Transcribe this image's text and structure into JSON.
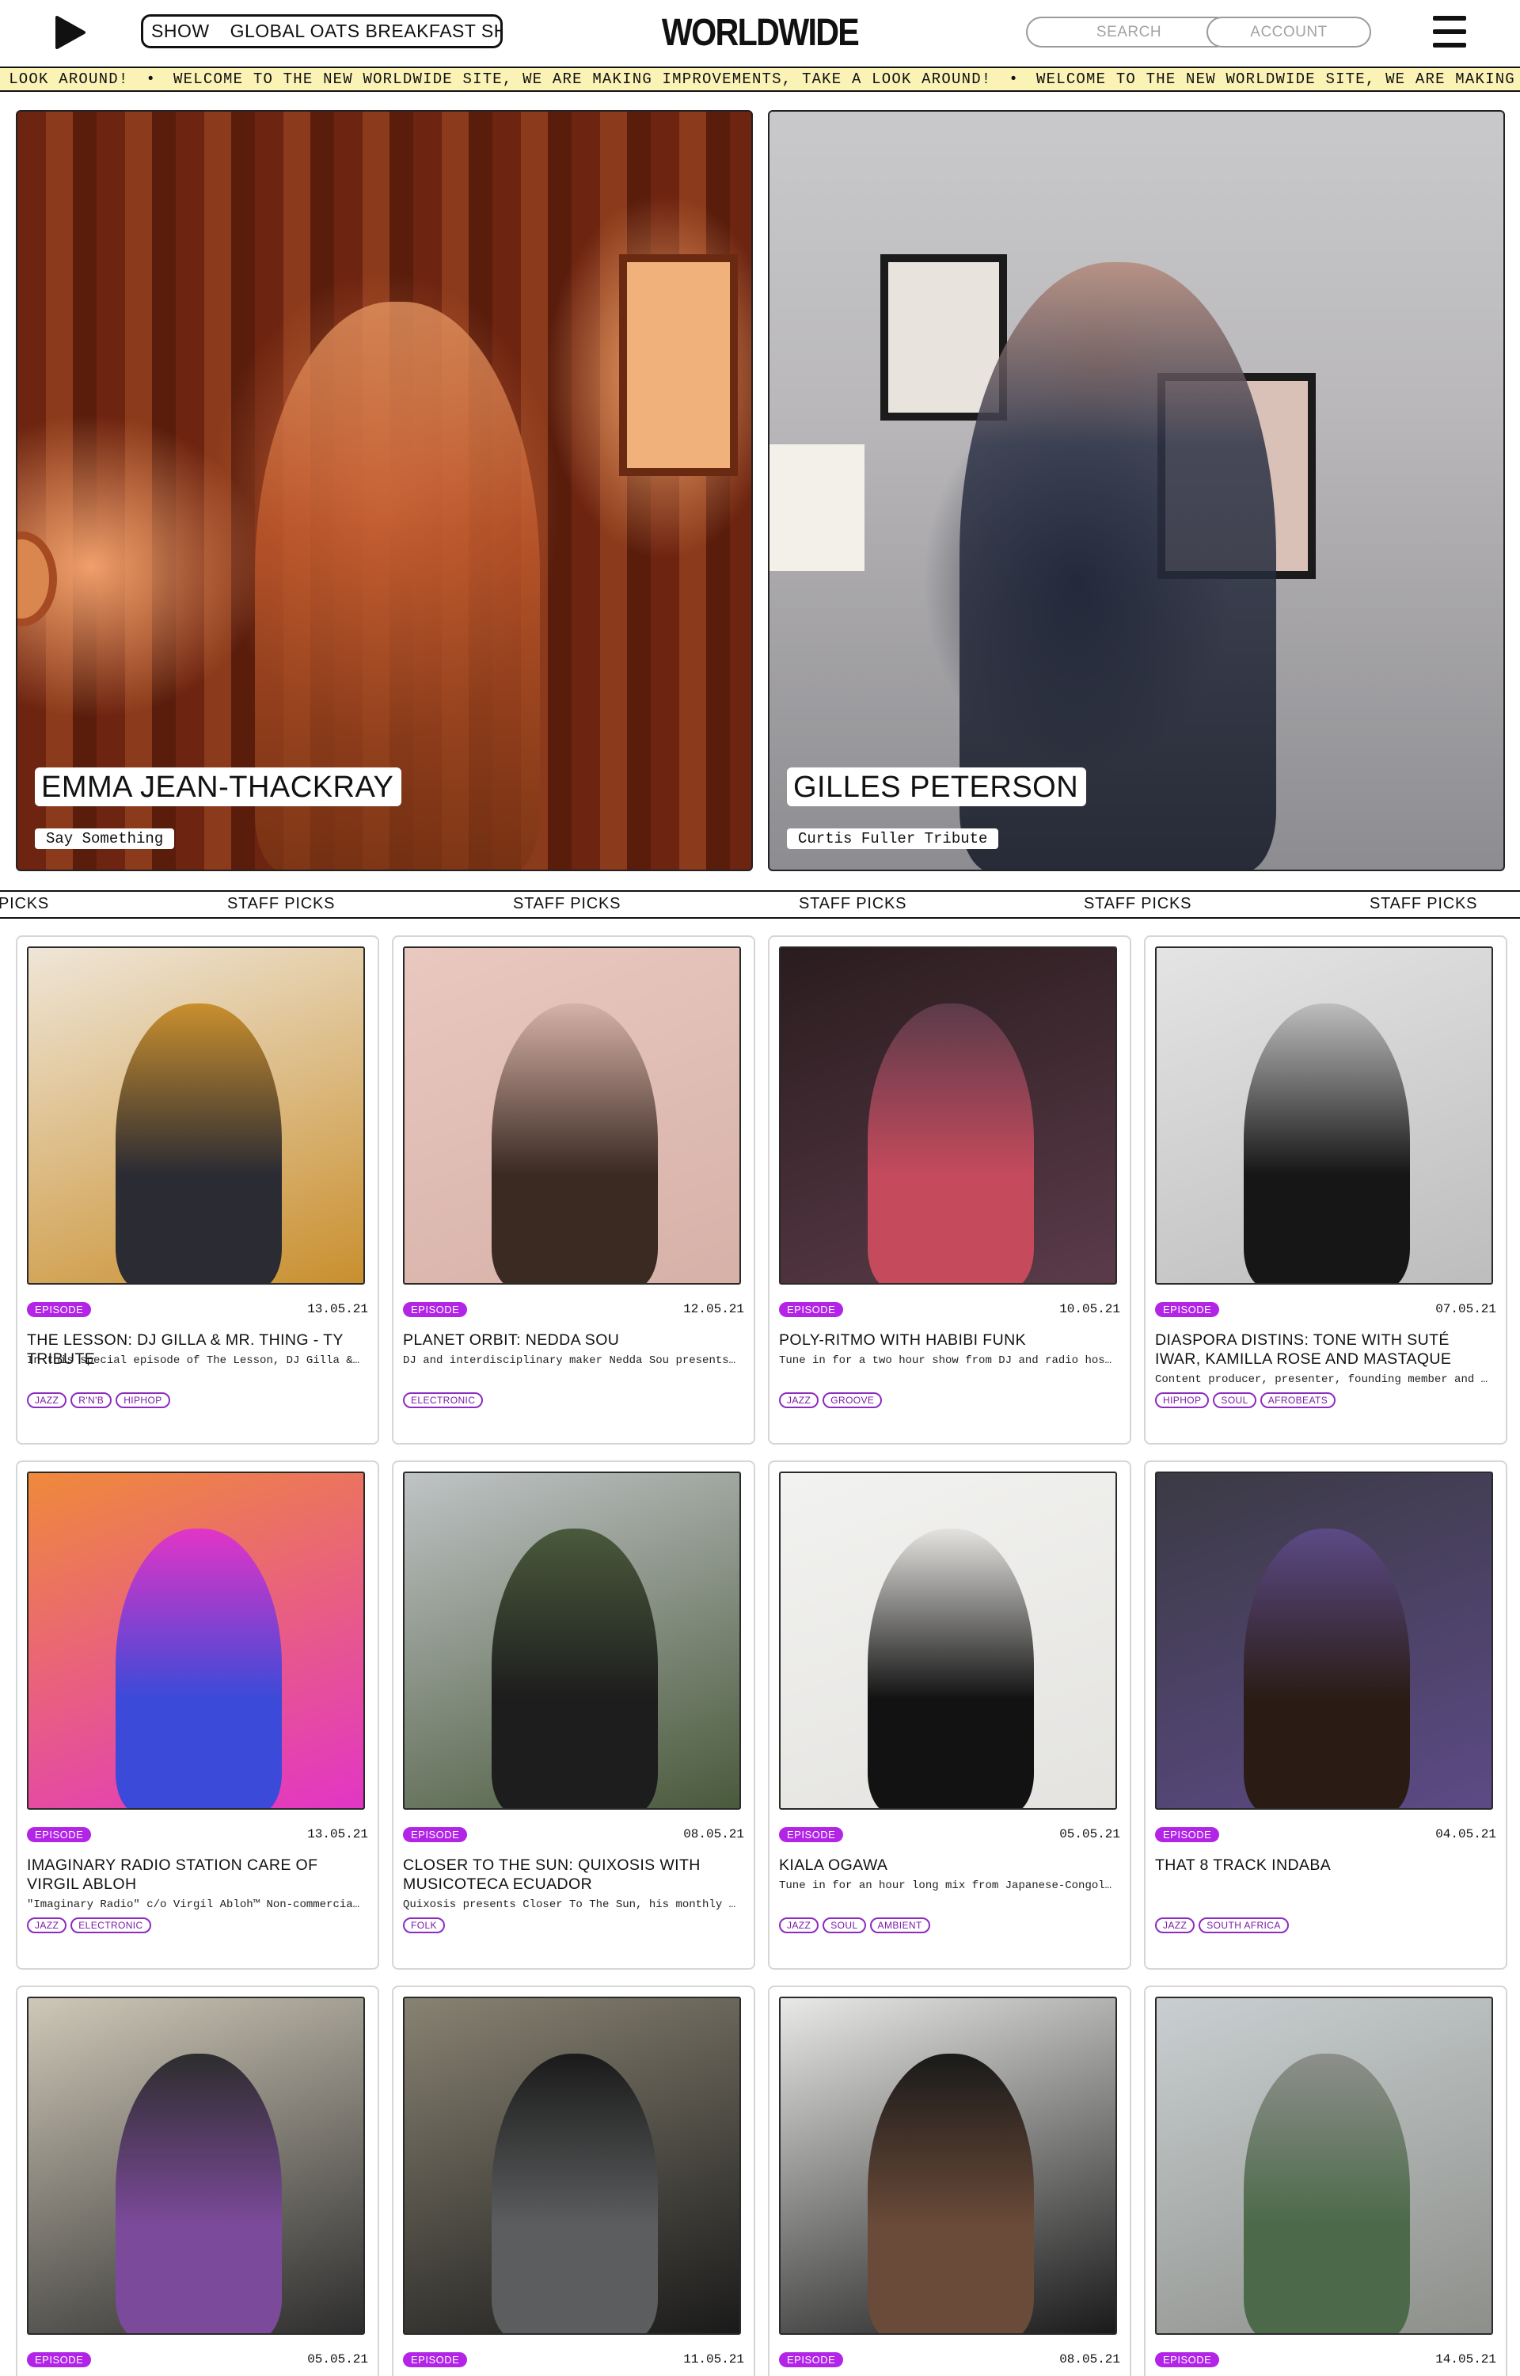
{
  "header": {
    "now_playing_show": "SHOW",
    "now_playing_title": "GLOBAL OATS BREAKFAST SHOW",
    "logo": "WORLDWIDE",
    "search_placeholder": "SEARCH",
    "account_label": "ACCOUNT"
  },
  "ticker": {
    "lead": "A LOOK AROUND!",
    "message": "WELCOME TO THE NEW WORLDWIDE SITE, WE ARE MAKING IMPROVEMENTS, TAKE A LOOK AROUND!",
    "trail": "WELCOME TO THE NEW WORLDWIDE SITE, WE ARE MAKING IMPR",
    "separator": "•"
  },
  "hero": [
    {
      "name": "EMMA JEAN-THACKRAY",
      "subtitle": "Say Something"
    },
    {
      "name": "GILLES PETERSON",
      "subtitle": "Curtis Fuller Tribute"
    }
  ],
  "staff_picks": {
    "label": "STAFF PICKS",
    "lead_fragment": "PICKS"
  },
  "colors": {
    "accent": "#b224e6",
    "ticker_bg": "#fbf2b6",
    "tag_border": "#8d2bc0"
  },
  "cards": [
    {
      "badge": "EPISODE",
      "date": "13.05.21",
      "title": "THE LESSON: DJ GILLA & MR. THING - TY TRIBUTE",
      "desc": "In this special episode of The Lesson, DJ Gilla & Mr. Thing pay tribute",
      "tags": [
        "JAZZ",
        "R'N'B",
        "HIPHOP"
      ]
    },
    {
      "badge": "EPISODE",
      "date": "12.05.21",
      "title": "PLANET ORBIT: NEDDA SOU",
      "desc": "DJ and interdisciplinary maker Nedda Sou presents Planet Orbit",
      "tags": [
        "ELECTRONIC"
      ]
    },
    {
      "badge": "EPISODE",
      "date": "10.05.21",
      "title": "POLY-RITMO WITH HABIBI FUNK",
      "desc": "Tune in for a two hour show from DJ and radio host Habibi Funk",
      "tags": [
        "JAZZ",
        "GROOVE"
      ]
    },
    {
      "badge": "EPISODE",
      "date": "07.05.21",
      "title": "DIASPORA DISTINS: TONE WITH SUTÉ IWAR, KAMILLA ROSE AND MASTAQUE",
      "desc": "Content producer, presenter, founding member and former host",
      "tags": [
        "HIPHOP",
        "SOUL",
        "AFROBEATS"
      ]
    },
    {
      "badge": "EPISODE",
      "date": "13.05.21",
      "title": "IMAGINARY RADIO STATION CARE OF VIRGIL ABLOH",
      "desc": "\"Imaginary Radio\" c/o Virgil Abloh™ Non-commercial radio station",
      "tags": [
        "JAZZ",
        "ELECTRONIC"
      ]
    },
    {
      "badge": "EPISODE",
      "date": "08.05.21",
      "title": "CLOSER TO THE SUN: QUIXOSIS WITH MUSICOTECA ECUADOR",
      "desc": "Quixosis presents Closer To The Sun, his monthly show exploring",
      "tags": [
        "FOLK"
      ]
    },
    {
      "badge": "EPISODE",
      "date": "05.05.21",
      "title": "KIALA OGAWA",
      "desc": "Tune in for an hour long mix from Japanese-Congolese artist Kiala",
      "tags": [
        "JAZZ",
        "SOUL",
        "AMBIENT"
      ]
    },
    {
      "badge": "EPISODE",
      "date": "04.05.21",
      "title": "THAT 8 TRACK INDABA",
      "desc": "",
      "tags": [
        "JAZZ",
        "SOUTH AFRICA"
      ]
    },
    {
      "badge": "EPISODE",
      "date": "05.05.21",
      "title": "",
      "desc": "",
      "tags": []
    },
    {
      "badge": "EPISODE",
      "date": "11.05.21",
      "title": "",
      "desc": "",
      "tags": []
    },
    {
      "badge": "EPISODE",
      "date": "08.05.21",
      "title": "",
      "desc": "",
      "tags": []
    },
    {
      "badge": "EPISODE",
      "date": "14.05.21",
      "title": "",
      "desc": "",
      "tags": []
    }
  ]
}
